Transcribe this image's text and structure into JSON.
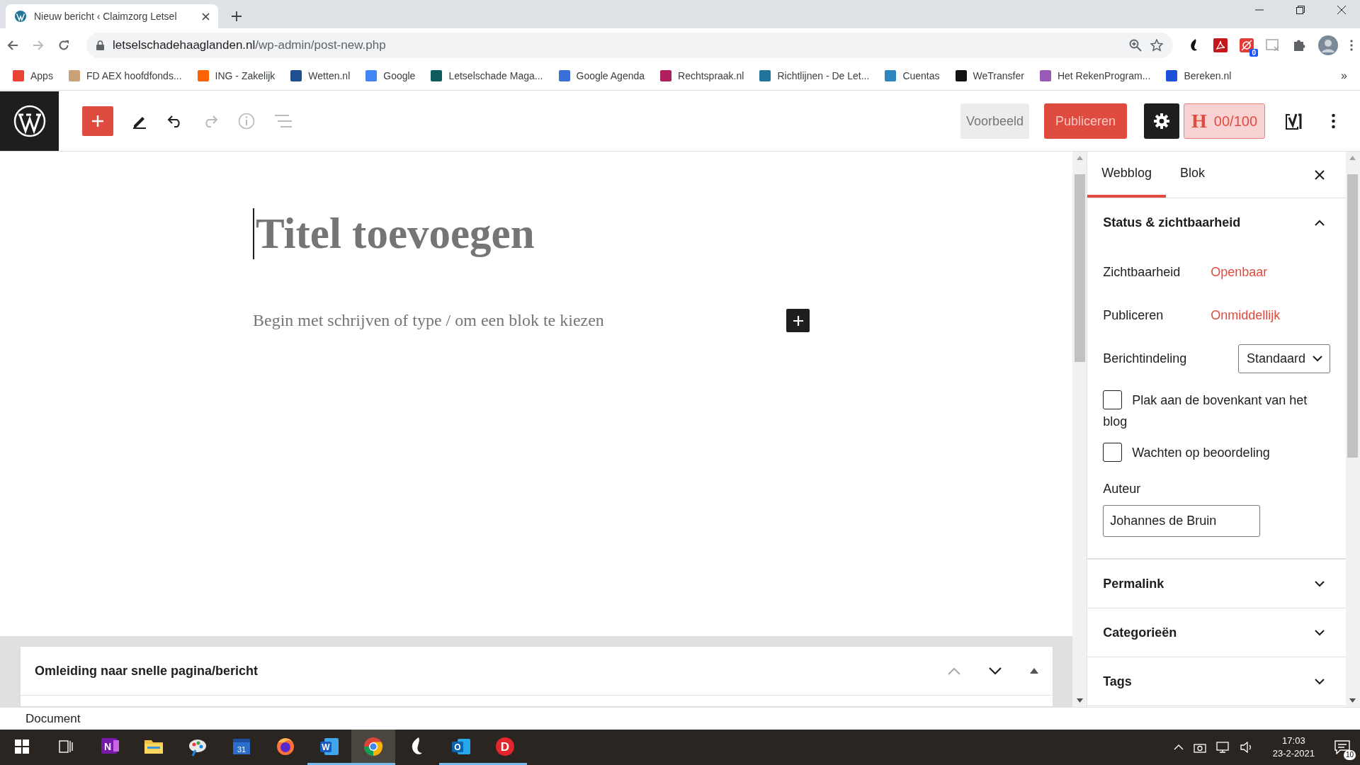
{
  "browser": {
    "tab": {
      "title": "Nieuw bericht ‹ Claimzorg Letsel",
      "selected": true
    },
    "url": {
      "host": "letselschadehaaglanden.nl",
      "path": "/wp-admin/post-new.php"
    },
    "extension_badge": "0",
    "bookmarks": [
      {
        "label": "Apps",
        "color": "#ea4335"
      },
      {
        "label": "FD AEX hoofdfonds...",
        "color": "#c9a27a"
      },
      {
        "label": "ING - Zakelijk",
        "color": "#ff6200"
      },
      {
        "label": "Wetten.nl",
        "color": "#1d4f91"
      },
      {
        "label": "Google",
        "color": "#4285f4"
      },
      {
        "label": "Letselschade Maga...",
        "color": "#0f5c5c"
      },
      {
        "label": "Google Agenda",
        "color": "#3a6fd8"
      },
      {
        "label": "Rechtspraak.nl",
        "color": "#b0205e"
      },
      {
        "label": "Richtlijnen - De Let...",
        "color": "#21759b"
      },
      {
        "label": "Cuentas",
        "color": "#2e86c1"
      },
      {
        "label": "WeTransfer",
        "color": "#111111"
      },
      {
        "label": "Het RekenProgram...",
        "color": "#9b59b6"
      },
      {
        "label": "Bereken.nl",
        "color": "#1e4fd8"
      }
    ],
    "more_bookmarks": "»"
  },
  "toolbar": {
    "preview": "Voorbeeld",
    "publish": "Publiceren",
    "seo": {
      "letter": "H",
      "score": "00/100"
    }
  },
  "editor": {
    "title_placeholder": "Titel toevoegen",
    "body_placeholder": "Begin met schrijven of type / om een blok te kiezen"
  },
  "sidebar": {
    "tabs": [
      {
        "label": "Webblog",
        "selected": true
      },
      {
        "label": "Blok",
        "selected": false
      }
    ],
    "status_panel": {
      "title": "Status & zichtbaarheid",
      "expanded": true,
      "rows": [
        {
          "label": "Zichtbaarheid",
          "value": "Openbaar"
        },
        {
          "label": "Publiceren",
          "value": "Onmiddellijk"
        }
      ],
      "format": {
        "label": "Berichtindeling",
        "value": "Standaard"
      },
      "checkboxes": [
        {
          "label": "Plak aan de bovenkant van het blog",
          "checked": false
        },
        {
          "label": "Wachten op beoordeling",
          "checked": false
        }
      ],
      "author": {
        "label": "Auteur",
        "value": "Johannes de Bruin"
      }
    },
    "panels": [
      {
        "title": "Permalink",
        "expanded": false
      },
      {
        "title": "Categorieën",
        "expanded": false
      },
      {
        "title": "Tags",
        "expanded": false
      }
    ]
  },
  "meta_box": {
    "title": "Omleiding naar snelle pagina/bericht"
  },
  "status_bar": {
    "breadcrumb": "Document"
  },
  "taskbar": {
    "apps": [
      {
        "kind": "onenote",
        "glyph": "N",
        "running": false,
        "selected": false
      },
      {
        "kind": "explorer",
        "running": false,
        "selected": false
      },
      {
        "kind": "paint",
        "running": false,
        "selected": false
      },
      {
        "kind": "calendar",
        "glyph": "31",
        "running": false,
        "selected": false
      },
      {
        "kind": "firefox",
        "running": false,
        "selected": false
      },
      {
        "kind": "word",
        "glyph": "W",
        "running": true,
        "selected": false
      },
      {
        "kind": "chrome",
        "running": true,
        "selected": true
      },
      {
        "kind": "dragon",
        "running": false,
        "selected": false
      },
      {
        "kind": "outlook",
        "glyph": "O",
        "running": true,
        "selected": false
      },
      {
        "kind": "d-app",
        "glyph": "D",
        "running": true,
        "selected": false
      }
    ],
    "clock": {
      "time": "17:03",
      "date": "23-2-2021"
    },
    "notifications": "10"
  }
}
